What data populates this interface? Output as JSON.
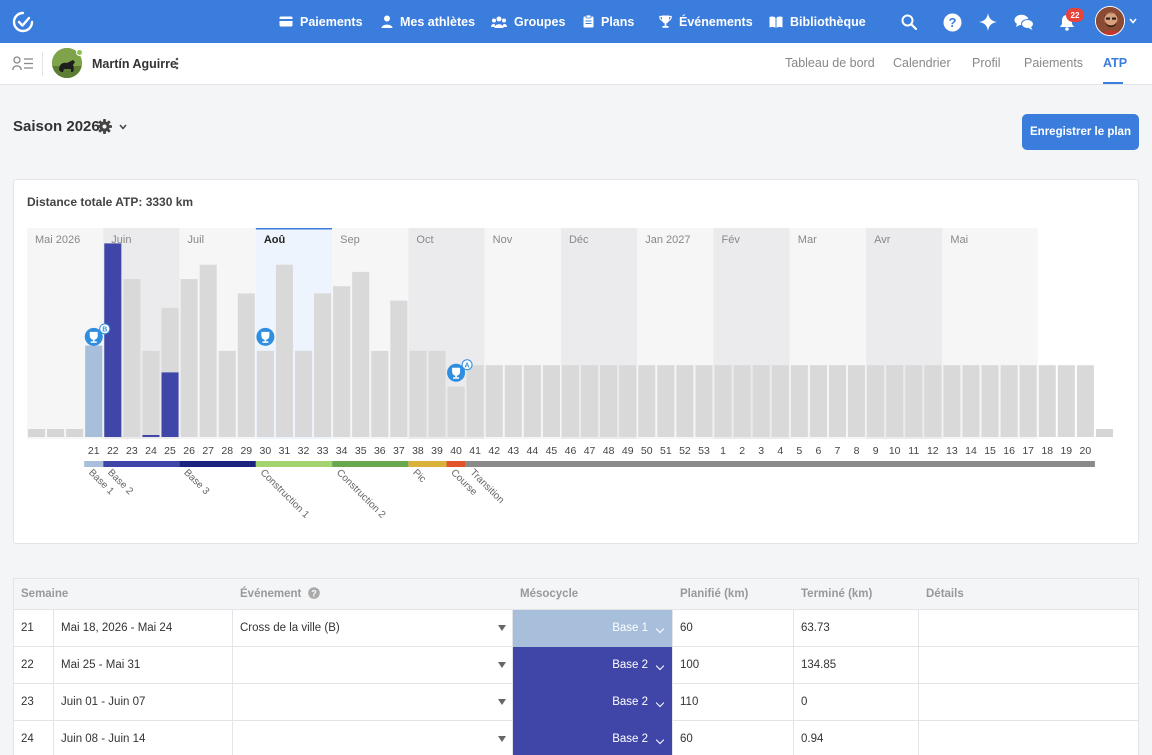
{
  "nav": {
    "items": [
      {
        "label": "Paiements",
        "icon": "card-icon"
      },
      {
        "label": "Mes athlètes",
        "icon": "person-icon"
      },
      {
        "label": "Groupes",
        "icon": "group-icon"
      },
      {
        "label": "Plans",
        "icon": "clipboard-icon"
      },
      {
        "label": "Événements",
        "icon": "trophy-icon"
      },
      {
        "label": "Bibliothèque",
        "icon": "book-icon"
      }
    ],
    "notification_count": "22"
  },
  "athlete": {
    "name": "Martín Aguirre"
  },
  "tabs": [
    {
      "label": "Tableau de bord",
      "active": false
    },
    {
      "label": "Calendrier",
      "active": false
    },
    {
      "label": "Profil",
      "active": false
    },
    {
      "label": "Paiements",
      "active": false
    },
    {
      "label": "ATP",
      "active": true
    }
  ],
  "season": {
    "title": "Saison 2026"
  },
  "save_label": "Enregistrer le plan",
  "chart_title": "Distance totale ATP: 3330 km",
  "chart_data": {
    "type": "bar",
    "months": [
      {
        "label": "Mai 2026",
        "weeks": 4,
        "bold": false,
        "highlight": false
      },
      {
        "label": "Juin",
        "weeks": 4,
        "bold": false,
        "highlight": false
      },
      {
        "label": "Juil",
        "weeks": 4,
        "bold": false,
        "highlight": false
      },
      {
        "label": "Aoû",
        "weeks": 4,
        "bold": true,
        "highlight": true
      },
      {
        "label": "Sep",
        "weeks": 4,
        "bold": false,
        "highlight": false
      },
      {
        "label": "Oct",
        "weeks": 4,
        "bold": false,
        "highlight": false
      },
      {
        "label": "Nov",
        "weeks": 4,
        "bold": false,
        "highlight": false
      },
      {
        "label": "Déc",
        "weeks": 4,
        "bold": false,
        "highlight": false
      },
      {
        "label": "Jan 2027",
        "weeks": 4,
        "bold": false,
        "highlight": false
      },
      {
        "label": "Fév",
        "weeks": 4,
        "bold": false,
        "highlight": false
      },
      {
        "label": "Mar",
        "weeks": 4,
        "bold": false,
        "highlight": false
      },
      {
        "label": "Avr",
        "weeks": 4,
        "bold": false,
        "highlight": false
      },
      {
        "label": "Mai",
        "weeks": 4,
        "bold": false,
        "highlight": false
      }
    ],
    "lead_empty_weeks": 3,
    "weeks": [
      "21",
      "22",
      "23",
      "24",
      "25",
      "26",
      "27",
      "28",
      "29",
      "30",
      "31",
      "32",
      "33",
      "34",
      "35",
      "36",
      "37",
      "38",
      "39",
      "40",
      "41",
      "42",
      "43",
      "44",
      "45",
      "46",
      "47",
      "48",
      "49",
      "50",
      "51",
      "52",
      "53",
      "1",
      "2",
      "3",
      "4",
      "5",
      "6",
      "7",
      "8",
      "9",
      "10",
      "11",
      "12",
      "13",
      "14",
      "15",
      "16",
      "17",
      "18",
      "19",
      "20"
    ],
    "planned": [
      60,
      100,
      110,
      60,
      90,
      110,
      120,
      60,
      100,
      60,
      120,
      60,
      100,
      105,
      115,
      60,
      95,
      60,
      60,
      35,
      50,
      50,
      50,
      50,
      50,
      50,
      50,
      50,
      50,
      50,
      50,
      50,
      50,
      50,
      50,
      50,
      50,
      50,
      50,
      50,
      50,
      50,
      50,
      50,
      50,
      50,
      50,
      50,
      50,
      50,
      50,
      50,
      50
    ],
    "completed": [
      63.73,
      134.85,
      0,
      0.94,
      45
    ],
    "completed_colors": [
      "#a8bfdc",
      "#4046a8",
      "#4046a8",
      "#4046a8",
      "#4046a8"
    ],
    "ymax": 140,
    "events": [
      {
        "week_index": 0,
        "priority": "B"
      },
      {
        "week_index": 9,
        "priority": ""
      },
      {
        "week_index": 19,
        "priority": "A"
      }
    ],
    "phases": [
      {
        "label": "Base 1",
        "start": 0,
        "weeks": 1,
        "color": "#a8bfdc"
      },
      {
        "label": "Base 2",
        "start": 1,
        "weeks": 4,
        "color": "#4046a8"
      },
      {
        "label": "Base 3",
        "start": 5,
        "weeks": 4,
        "color": "#1a237e"
      },
      {
        "label": "Construction 1",
        "start": 9,
        "weeks": 4,
        "color": "#a5d36e"
      },
      {
        "label": "Construction 2",
        "start": 13,
        "weeks": 4,
        "color": "#6aa84f"
      },
      {
        "label": "Pic",
        "start": 17,
        "weeks": 2,
        "color": "#d9b23c"
      },
      {
        "label": "Course",
        "start": 19,
        "weeks": 1,
        "color": "#e0532b"
      },
      {
        "label": "Transition",
        "start": 20,
        "weeks": 33,
        "color": "#8a8a8a"
      }
    ]
  },
  "table": {
    "headers": [
      "Semaine",
      "Événement",
      "Mésocycle",
      "Planifié (km)",
      "Terminé (km)",
      "Détails"
    ],
    "rows": [
      {
        "week": "21",
        "dates": "Mai 18, 2026 - Mai 24",
        "event": "Cross de la ville (B)",
        "meso": "Base 1",
        "meso_color": "#a8bfdc",
        "planned": "60",
        "completed": "63.73",
        "details": ""
      },
      {
        "week": "22",
        "dates": "Mai 25 - Mai 31",
        "event": "",
        "meso": "Base 2",
        "meso_color": "#4046a8",
        "planned": "100",
        "completed": "134.85",
        "details": ""
      },
      {
        "week": "23",
        "dates": "Juin 01 - Juin 07",
        "event": "",
        "meso": "Base 2",
        "meso_color": "#4046a8",
        "planned": "110",
        "completed": "0",
        "details": ""
      },
      {
        "week": "24",
        "dates": "Juin 08 - Juin 14",
        "event": "",
        "meso": "Base 2",
        "meso_color": "#4046a8",
        "planned": "60",
        "completed": "0.94",
        "details": ""
      }
    ]
  }
}
